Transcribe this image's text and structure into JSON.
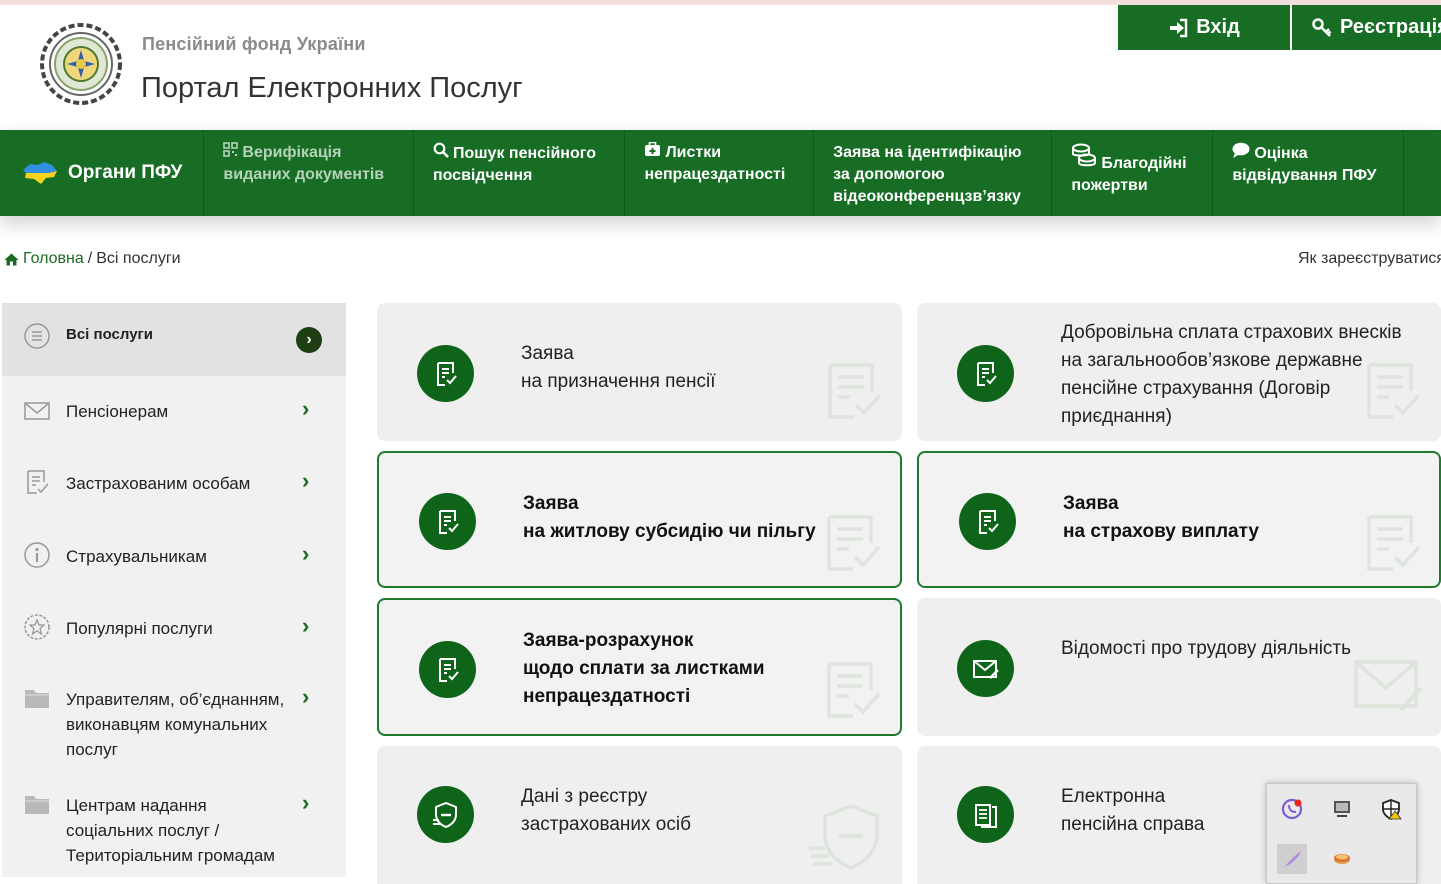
{
  "header": {
    "org_name": "Пенсійний фонд України",
    "portal_title": "Портал Електронних Послуг",
    "login_label": "Вхід",
    "register_label": "Реєстрація"
  },
  "nav": {
    "organs": "Органи ПФУ",
    "verification_line1": "Верифікація",
    "verification_line2": "виданих документів",
    "search_line1": "Пошук пенсійного",
    "search_line2": "посвідчення",
    "sick_line1": "Листки",
    "sick_line2": "непрацездатності",
    "ident_line1": "Заява на ідентифікацію",
    "ident_line2": "за допомогою",
    "ident_line3": "відеоконференцзв’язку",
    "charity_line1": "Благодійні",
    "charity_line2": "пожертви",
    "rating_line1": "Оцінка",
    "rating_line2": "відвідування ПФУ"
  },
  "breadcrumb": {
    "home": "Головна",
    "separator": "/",
    "current": "Всі послуги",
    "how_to_register": "Як зареєструватися"
  },
  "sidebar": {
    "items": [
      {
        "label": "Всі послуги",
        "icon": "list-circle-icon"
      },
      {
        "label": "Пенсіонерам",
        "icon": "envelope-icon"
      },
      {
        "label": "Застрахованим особам",
        "icon": "document-check-icon"
      },
      {
        "label": "Страхувальникам",
        "icon": "info-circle-icon"
      },
      {
        "label": "Популярні послуги",
        "icon": "star-badge-icon"
      },
      {
        "label_lines": [
          "Управителям, об’єднанням,",
          "виконавцям комунальних",
          "послуг"
        ],
        "icon": "folder-icon"
      },
      {
        "label_lines": [
          "Центрам надання",
          "соціальних послуг /",
          "Територіальним громадам"
        ],
        "icon": "folder-icon"
      }
    ]
  },
  "cards": [
    {
      "lines": [
        "Заява",
        "на призначення пенсії"
      ],
      "icon": "document-check-icon"
    },
    {
      "lines": [
        "Добровільна сплата страхових внесків",
        "на загальнообов’язкове державне",
        "пенсійне страхування (Договір",
        "приєднання)"
      ],
      "icon": "document-check-icon"
    },
    {
      "lines": [
        "Заява",
        "на житлову субсидію чи пільгу"
      ],
      "icon": "document-check-icon"
    },
    {
      "lines": [
        "Заява",
        "на страхову виплату"
      ],
      "icon": "document-check-icon"
    },
    {
      "lines": [
        "Заява-розрахунок",
        "щодо сплати за листками",
        "непрацездатності"
      ],
      "icon": "document-check-icon"
    },
    {
      "lines": [
        "Відомості про трудову діяльність"
      ],
      "icon": "envelope-pen-icon"
    },
    {
      "lines": [
        "Дані з реєстру",
        "застрахованих осіб"
      ],
      "icon": "shield-hand-icon"
    },
    {
      "lines": [
        "Електронна",
        "пенсійна справа"
      ],
      "icon": "document-stack-icon"
    }
  ],
  "colors": {
    "brand_green": "#176d24",
    "dark_green_circle": "#0e6519",
    "card_bg": "#efefef",
    "sidebar_bg": "#f1f1f1"
  },
  "tray": {
    "icons": [
      "viber-icon",
      "display-icon",
      "shield-warning-icon",
      "feather-icon",
      "folder-cake-icon"
    ]
  }
}
